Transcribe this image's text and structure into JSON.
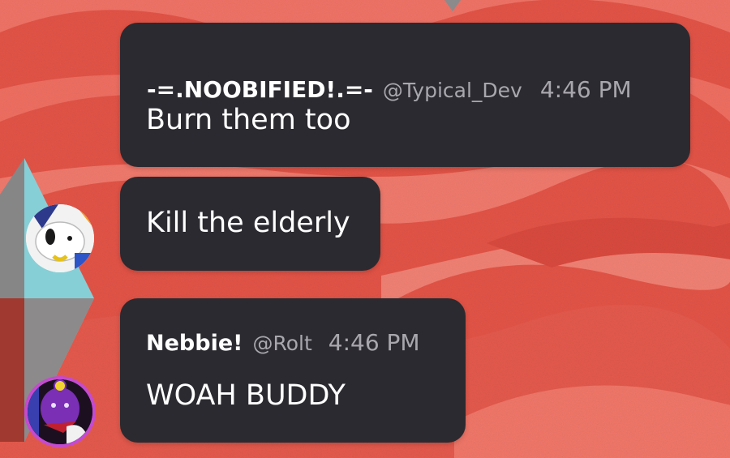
{
  "theme": {
    "background": "#e5574b",
    "bubble": "#2b2a30",
    "text": "#ffffff",
    "muted": "#a9a7ae"
  },
  "messages": [
    {
      "display_name": "-=.NOOBIFIED!.=-",
      "handle": "@Typical_Dev",
      "time": "4:46 PM",
      "text": "Burn them too"
    },
    {
      "text": "Kill the elderly"
    },
    {
      "display_name": "Nebbie!",
      "handle": "@Rolt",
      "time": "4:46 PM",
      "text": "WOAH BUDDY"
    }
  ],
  "icons": {
    "avatar_1": "cartoon-dog-avatar",
    "avatar_2": "purple-character-avatar"
  }
}
